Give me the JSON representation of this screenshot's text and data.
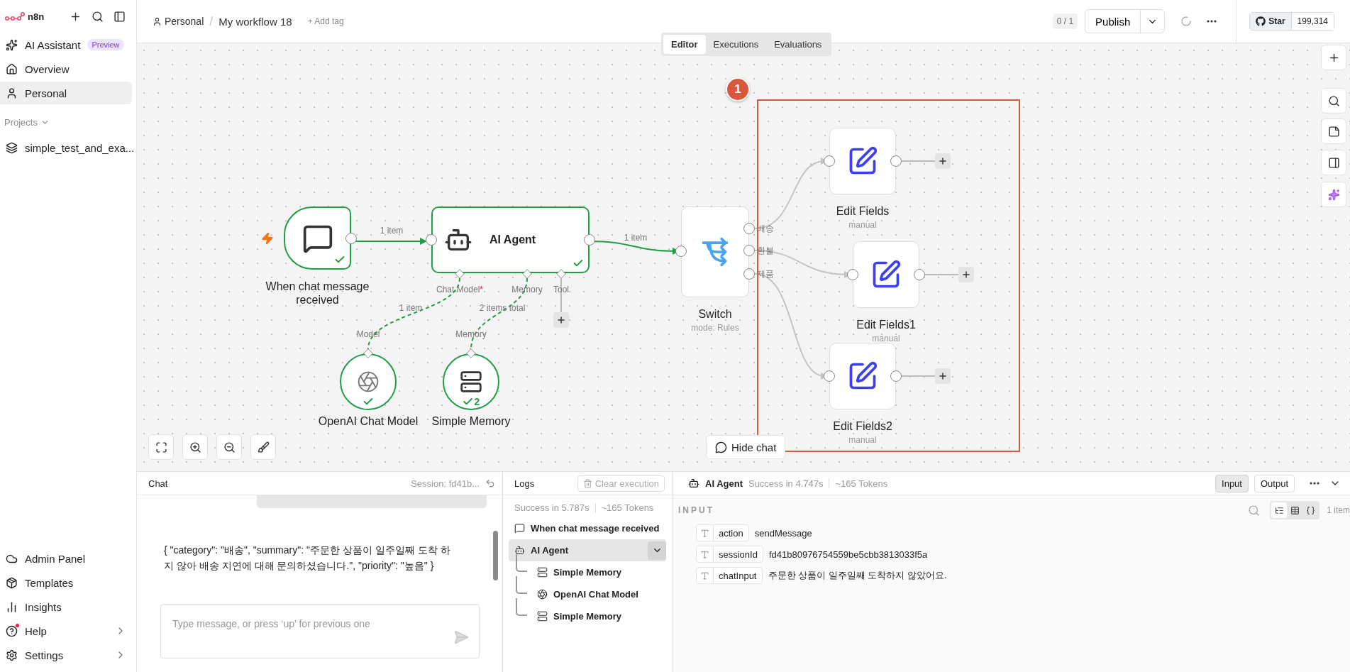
{
  "sidebar": {
    "logo": "n8n",
    "nav": [
      {
        "label": "AI Assistant",
        "badge": "Preview",
        "selected": false
      },
      {
        "label": "Overview",
        "selected": false
      },
      {
        "label": "Personal",
        "selected": true
      }
    ],
    "projects_heading": "Projects",
    "projects": [
      {
        "label": "simple_test_and_exa...",
        "selected": false
      }
    ],
    "footer": [
      {
        "label": "Admin Panel",
        "submenu": false,
        "notification": false
      },
      {
        "label": "Templates",
        "submenu": false,
        "notification": false
      },
      {
        "label": "Insights",
        "submenu": false,
        "notification": false
      },
      {
        "label": "Help",
        "submenu": true,
        "notification": true
      },
      {
        "label": "Settings",
        "submenu": true,
        "notification": false
      }
    ]
  },
  "header": {
    "project": "Personal",
    "separator": "/",
    "workflow": "My workflow 18",
    "add_tag": "+ Add tag",
    "counter": "0 / 1",
    "publish": "Publish",
    "github": {
      "label": "Star",
      "count": "199,314"
    }
  },
  "view_tabs": [
    {
      "label": "Editor",
      "selected": true
    },
    {
      "label": "Executions",
      "selected": false
    },
    {
      "label": "Evaluations",
      "selected": false
    }
  ],
  "canvas": {
    "nodes": [
      {
        "kind": "chat_trigger",
        "name": "When chat message received",
        "success": true
      },
      {
        "kind": "agent",
        "name": "AI Agent",
        "success": true,
        "inputs": [
          {
            "label": "Chat Model",
            "required_mark": "*"
          },
          {
            "label": "Memory"
          },
          {
            "label": "Tool"
          }
        ]
      },
      {
        "kind": "chat_model",
        "name": "OpenAI Chat Model",
        "port_label": "Model",
        "success": true
      },
      {
        "kind": "memory",
        "name": "Simple Memory",
        "port_label": "Memory",
        "success": true,
        "run_count": "2"
      },
      {
        "kind": "switch",
        "name": "Switch",
        "subtitle": "mode: Rules",
        "success": false,
        "outputs": [
          {
            "label": "배송"
          },
          {
            "label": "환불"
          },
          {
            "label": "제품"
          }
        ]
      },
      {
        "kind": "edit",
        "name": "Edit Fields",
        "subtitle": "manual",
        "success": false
      },
      {
        "kind": "edit",
        "name": "Edit Fields1",
        "subtitle": "manual",
        "success": false
      },
      {
        "kind": "edit",
        "name": "Edit Fields2",
        "subtitle": "manual",
        "success": false
      }
    ],
    "edges": [
      {
        "kind": "main",
        "label": "1 item",
        "active": true
      },
      {
        "kind": "main",
        "label": "1 item",
        "active": true
      },
      {
        "kind": "ai",
        "label": "1 item",
        "active": true
      },
      {
        "kind": "ai",
        "label": "2 items total",
        "active": true
      },
      {
        "kind": "main",
        "active": false
      },
      {
        "kind": "main",
        "active": false
      },
      {
        "kind": "main",
        "active": false
      }
    ],
    "annotation": {
      "number": "1"
    },
    "hide_chat": "Hide chat"
  },
  "chat": {
    "title": "Chat",
    "session": "Session: fd41b...",
    "messages": [
      {
        "text": "{ \"category\": \"배송\", \"summary\": \"주문한 상품이 일주일째 도착 하지 않아 배송 지연에 대해 문의하셨습니다.\", \"priority\": \"높음\" }"
      }
    ],
    "input": {
      "placeholder": "Type message, or press ‘up’ for previous one"
    }
  },
  "logs": {
    "title": "Logs",
    "clear": "Clear execution",
    "status": "Success in 5.787s",
    "tokens": "~165 Tokens",
    "tree": [
      {
        "kind": "chat_trigger",
        "label": "When chat message received",
        "selected": false
      },
      {
        "kind": "agent",
        "label": "AI Agent",
        "selected": true,
        "expanded": true,
        "children": [
          {
            "kind": "memory",
            "label": "Simple Memory",
            "selected": false
          },
          {
            "kind": "chat_model",
            "label": "OpenAI Chat Model",
            "selected": false
          },
          {
            "kind": "memory",
            "label": "Simple Memory",
            "selected": false
          }
        ]
      }
    ]
  },
  "details": {
    "node": "AI Agent",
    "status": "Success in 4.747s",
    "tokens": "~165 Tokens",
    "modes": [
      {
        "label": "Input",
        "selected": true
      },
      {
        "label": "Output",
        "selected": false
      }
    ],
    "section": "INPUT",
    "views": [
      {
        "kind": "schema",
        "selected": true
      },
      {
        "kind": "table",
        "selected": false
      },
      {
        "kind": "json",
        "selected": false
      }
    ],
    "count": "1 item",
    "fields": [
      {
        "key": "action",
        "value": "sendMessage"
      },
      {
        "key": "sessionId",
        "value": "fd41b80976754559be5cbb3813033f5a"
      },
      {
        "key": "chatInput",
        "value": "주문한 상품이 일주일째 도착하지 않았어요."
      }
    ]
  }
}
